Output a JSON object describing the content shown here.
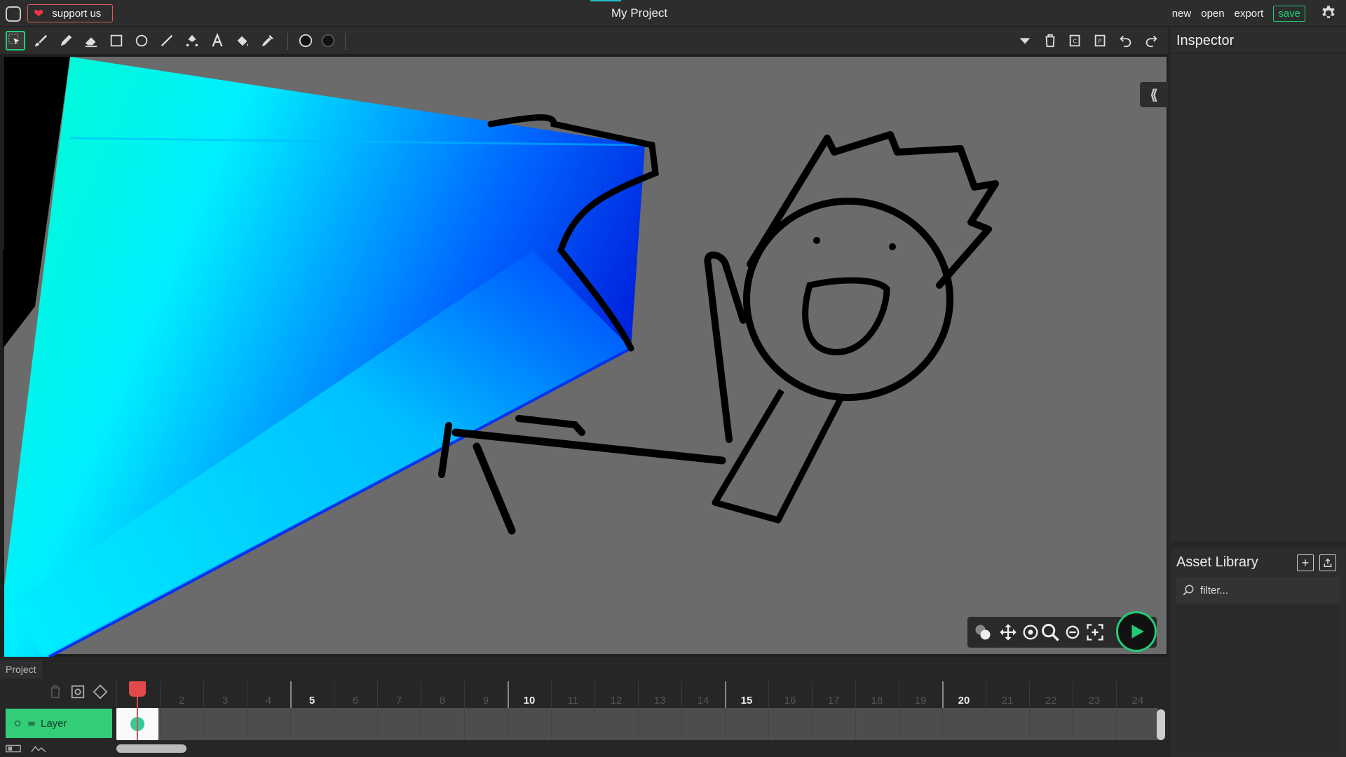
{
  "header": {
    "support_label": "support us",
    "title": "My Project",
    "actions": [
      "new",
      "open",
      "export"
    ],
    "save_label": "save"
  },
  "toolbar": {
    "tools": [
      "select-tool-icon",
      "brush-tool-icon",
      "pencil-tool-icon",
      "eraser-tool-icon",
      "rectangle-tool-icon",
      "ellipse-tool-icon",
      "line-tool-icon",
      "path-tool-icon",
      "text-tool-icon",
      "fill-tool-icon",
      "eyedropper-tool-icon"
    ],
    "active_tool": "select-tool-icon",
    "colors": {
      "fill": "#111111",
      "stroke": "#111111"
    },
    "right_actions": [
      "dropdown-icon",
      "delete-icon",
      "copy-icon",
      "paste-icon",
      "undo-icon",
      "redo-icon"
    ]
  },
  "inspector": {
    "title": "Inspector"
  },
  "assets": {
    "title": "Asset Library",
    "filter_placeholder": "filter..."
  },
  "timeline": {
    "tab": "Project",
    "layer_name": "Layer",
    "frame_labels": [
      "2",
      "3",
      "4",
      "5",
      "6",
      "7",
      "8",
      "9",
      "10",
      "11",
      "12",
      "13",
      "14",
      "15",
      "16",
      "17",
      "18",
      "19",
      "20",
      "21",
      "22",
      "23",
      "24"
    ],
    "major_frames": [
      "5",
      "10",
      "15",
      "20"
    ],
    "current_frame": 1
  },
  "colors": {
    "accent": "#22cc77",
    "playhead": "#e04a4a",
    "support_border": "#e05a5a",
    "stage": "#6b6b6b"
  }
}
